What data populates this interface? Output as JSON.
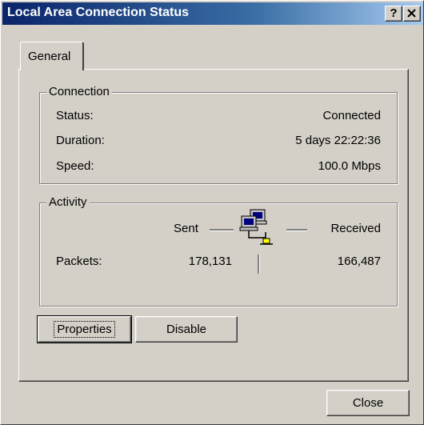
{
  "window": {
    "title": "Local Area Connection Status",
    "help_button": "?",
    "close_button": "X"
  },
  "tabs": [
    {
      "label": "General",
      "selected": true
    }
  ],
  "connection": {
    "group_label": "Connection",
    "rows": [
      {
        "label": "Status:",
        "value": "Connected"
      },
      {
        "label": "Duration:",
        "value": "5 days 22:22:36"
      },
      {
        "label": "Speed:",
        "value": "100.0 Mbps"
      }
    ]
  },
  "activity": {
    "group_label": "Activity",
    "sent_label": "Sent",
    "received_label": "Received",
    "packets_label": "Packets:",
    "packets_sent": "178,131",
    "packets_received": "166,487",
    "icon": "network-computers-icon"
  },
  "buttons": {
    "properties": "Properties",
    "disable": "Disable",
    "close": "Close"
  },
  "colors": {
    "face": "#d4d0c8",
    "title_start": "#0a246a",
    "title_end": "#a6caf0"
  }
}
